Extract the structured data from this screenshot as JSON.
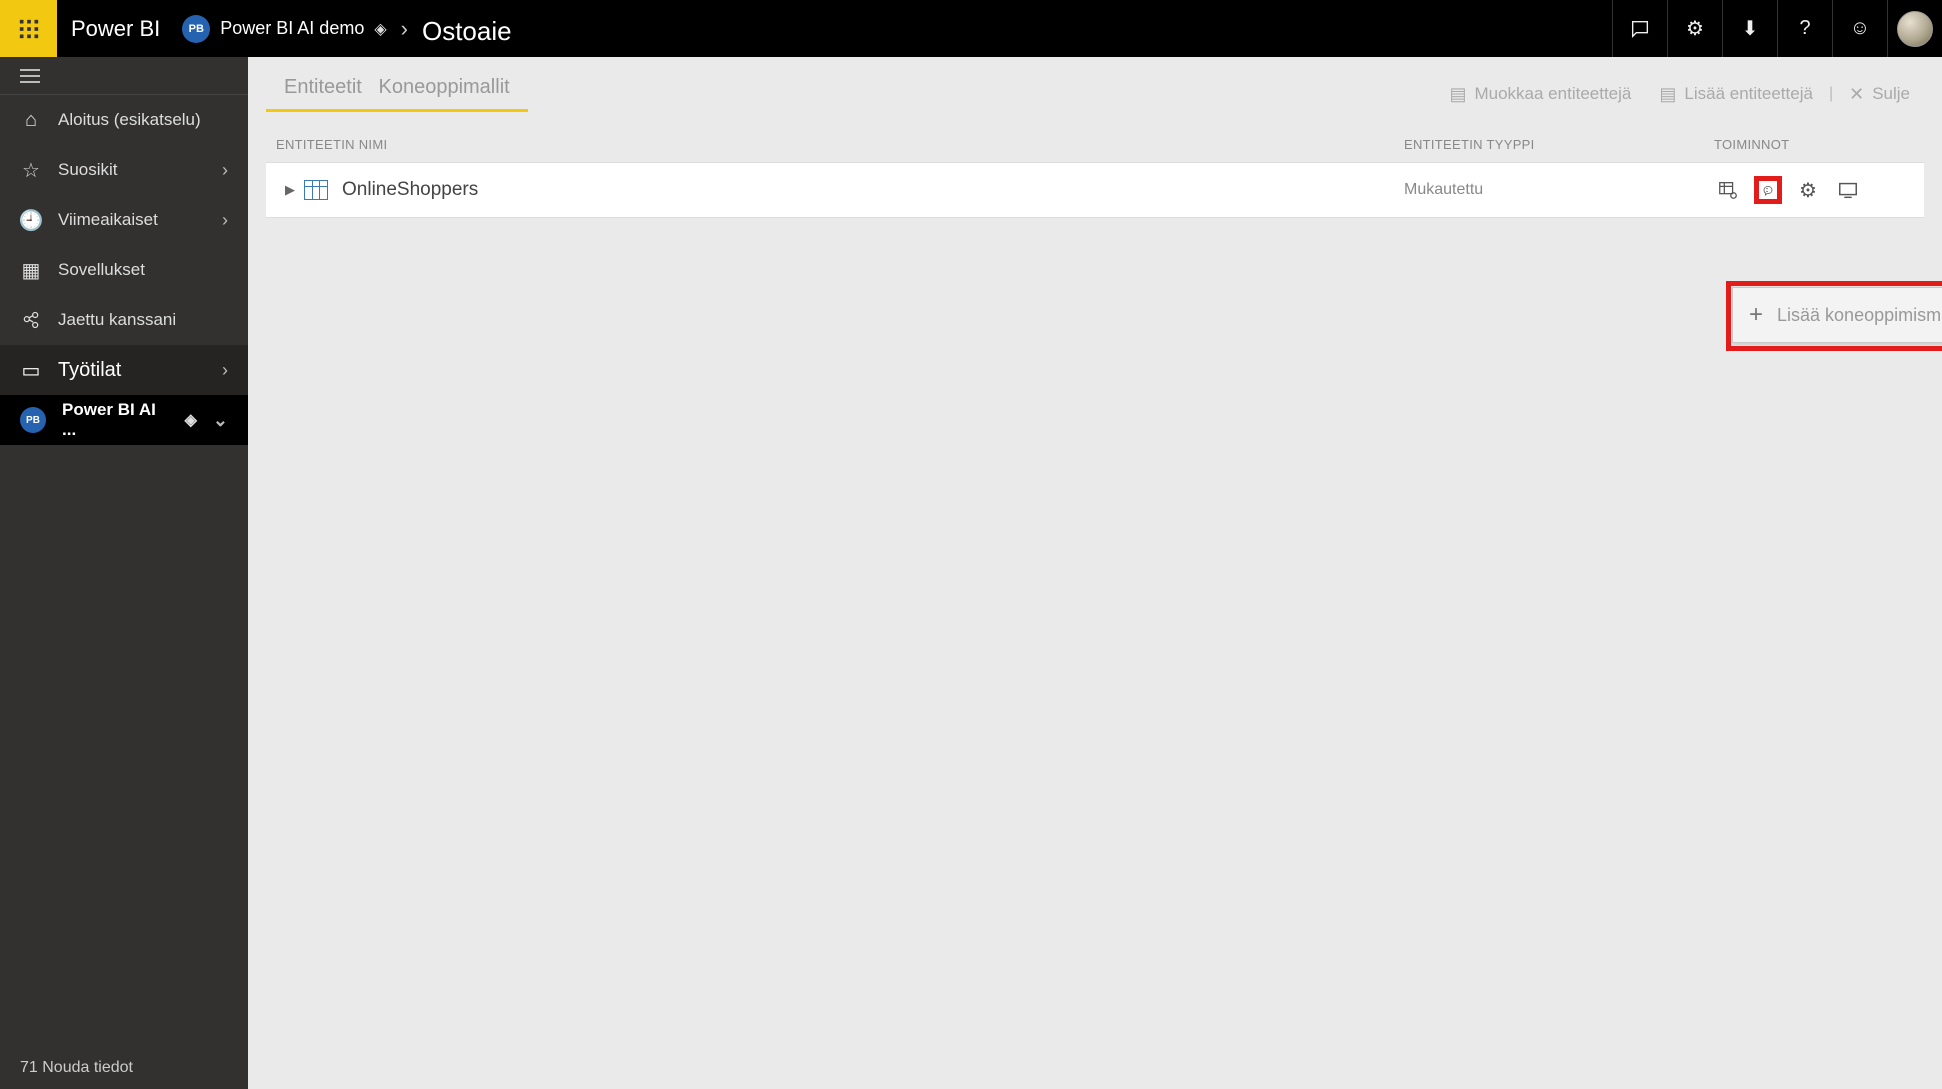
{
  "topbar": {
    "brand": "Power BI",
    "workspace_badge": "PB",
    "workspace_name": "Power BI AI demo",
    "page_title": "Ostoaie"
  },
  "nav": {
    "items": [
      {
        "icon": "home",
        "label": "Aloitus (esikatselu)",
        "chevron": false
      },
      {
        "icon": "star",
        "label": "Suosikit",
        "chevron": true
      },
      {
        "icon": "clock",
        "label": "Viimeaikaiset",
        "chevron": true
      },
      {
        "icon": "apps",
        "label": "Sovellukset",
        "chevron": false
      },
      {
        "icon": "share",
        "label": "Jaettu kanssani",
        "chevron": false
      }
    ],
    "workspaces_label": "Työtilat",
    "current_ws_badge": "PB",
    "current_ws_label": "Power BI AI ...",
    "footer": "71 Nouda tiedot"
  },
  "tabs": {
    "tab1": "Entiteetit",
    "tab2": "Koneoppimallit"
  },
  "actions": {
    "edit": "Muokkaa entiteettejä",
    "add": "Lisää entiteettejä",
    "close": "Sulje"
  },
  "columns": {
    "name": "ENTITEETIN NIMI",
    "type": "ENTITEETIN TYYPPI",
    "actions": "TOIMINNOT"
  },
  "entity": {
    "name": "OnlineShoppers",
    "type": "Mukautettu"
  },
  "popup": {
    "add_ml_model": "Lisää koneoppimismalli"
  }
}
